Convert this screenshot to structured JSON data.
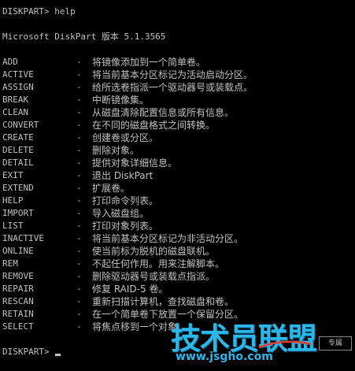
{
  "console": {
    "prompt_line": "DISKPART> help",
    "version_line": "Microsoft DiskPart 版本 5.1.3565",
    "dash": "-",
    "commands": [
      {
        "name": "ADD",
        "desc": "将镜像添加到一个简单卷。"
      },
      {
        "name": "ACTIVE",
        "desc": "将当前基本分区标记为活动启动分区。"
      },
      {
        "name": "ASSIGN",
        "desc": "给所选卷指派一个驱动器号或装载点。"
      },
      {
        "name": "BREAK",
        "desc": "中断镜像集。"
      },
      {
        "name": "CLEAN",
        "desc": "从磁盘清除配置信息或所有信息。"
      },
      {
        "name": "CONVERT",
        "desc": "在不同的磁盘格式之间转换。"
      },
      {
        "name": "CREATE",
        "desc": "创建卷或分区。"
      },
      {
        "name": "DELETE",
        "desc": "删除对象。"
      },
      {
        "name": "DETAIL",
        "desc": "提供对象详细信息。"
      },
      {
        "name": "EXIT",
        "desc": "退出 DiskPart"
      },
      {
        "name": "EXTEND",
        "desc": "扩展卷。"
      },
      {
        "name": "HELP",
        "desc": "打印命令列表。"
      },
      {
        "name": "IMPORT",
        "desc": "导入磁盘组。"
      },
      {
        "name": "LIST",
        "desc": "打印对象列表。"
      },
      {
        "name": "INACTIVE",
        "desc": "将当前基本分区标记为非活动分区。"
      },
      {
        "name": "ONLINE",
        "desc": "使当前标为脱机的磁盘联机。"
      },
      {
        "name": "REM",
        "desc": "不起任何作用。用来注解脚本。"
      },
      {
        "name": "REMOVE",
        "desc": "删除驱动器号或装载点指派。"
      },
      {
        "name": "REPAIR",
        "desc": "修复 RAID-5 卷。"
      },
      {
        "name": "RESCAN",
        "desc": "重新扫描计算机，查找磁盘和卷。"
      },
      {
        "name": "RETAIN",
        "desc": "在一个简单卷下放置一个保留分区。"
      },
      {
        "name": "SELECT",
        "desc": "将焦点移到一个对象。"
      }
    ],
    "final_prompt": "DISKPART>"
  },
  "watermark": {
    "title": "技术员联盟",
    "url": "www.jsgho.com",
    "badge": "专属"
  },
  "colors": {
    "background": "#000000",
    "text": "#c0c0c0",
    "watermark": "#2db6e8",
    "swoosh": "#e23b2f"
  }
}
